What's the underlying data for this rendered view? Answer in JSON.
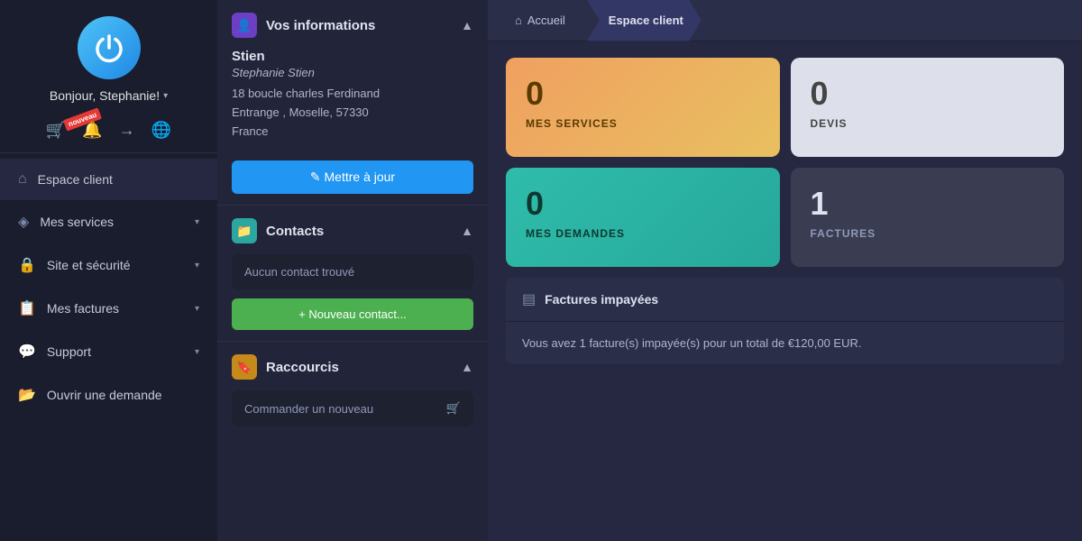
{
  "sidebar": {
    "logo_alt": "Power Logo",
    "greeting": "Bonjour, Stephanie!",
    "badge_new": "nouveau",
    "nav_items": [
      {
        "id": "espace-client",
        "label": "Espace client",
        "icon": "⌂",
        "has_chevron": false
      },
      {
        "id": "mes-services",
        "label": "Mes services",
        "icon": "◈",
        "has_chevron": true
      },
      {
        "id": "site-securite",
        "label": "Site et sécurité",
        "icon": "🔒",
        "has_chevron": true
      },
      {
        "id": "mes-factures",
        "label": "Mes factures",
        "icon": "📋",
        "has_chevron": true
      },
      {
        "id": "support",
        "label": "Support",
        "icon": "💬",
        "has_chevron": true
      },
      {
        "id": "ouvrir-demande",
        "label": "Ouvrir une demande",
        "icon": "📂",
        "has_chevron": false
      }
    ]
  },
  "middle": {
    "vos_informations": {
      "title": "Vos informations",
      "user_name": "Stien",
      "user_fullname": "Stephanie Stien",
      "address_line1": "18 boucle charles Ferdinand",
      "address_line2": "Entrange , Moselle, 57330",
      "address_line3": "France",
      "btn_update": "✎ Mettre à jour"
    },
    "contacts": {
      "title": "Contacts",
      "empty_message": "Aucun contact trouvé",
      "btn_new": "+ Nouveau contact..."
    },
    "raccourcis": {
      "title": "Raccourcis",
      "item1": "Commander un nouveau",
      "item1_icon": "🛒"
    }
  },
  "breadcrumb": {
    "home": "Accueil",
    "current": "Espace client"
  },
  "dashboard": {
    "cards": [
      {
        "id": "mes-services",
        "number": "0",
        "label": "MES SERVICES",
        "style": "orange"
      },
      {
        "id": "devis",
        "number": "0",
        "label": "DEVIS",
        "style": "white-gray"
      },
      {
        "id": "mes-demandes",
        "number": "0",
        "label": "MES DEMANDES",
        "style": "teal"
      },
      {
        "id": "factures",
        "number": "1",
        "label": "FACTURES",
        "style": "dark-gray"
      }
    ],
    "invoices": {
      "title": "Factures impayées",
      "message": "Vous avez 1 facture(s) impayée(s) pour un total de €120,00 EUR."
    }
  }
}
